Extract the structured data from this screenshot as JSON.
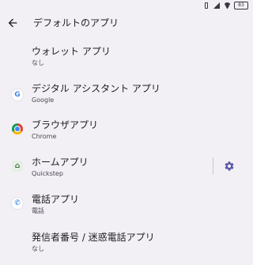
{
  "status": {
    "battery": "83"
  },
  "appbar": {
    "title": "デフォルトのアプリ"
  },
  "items": [
    {
      "title": "ウォレット アプリ",
      "subtitle": "なし",
      "icon": "none"
    },
    {
      "title": "デジタル アシスタント アプリ",
      "subtitle": "Google",
      "icon": "google-icon"
    },
    {
      "title": "ブラウザアプリ",
      "subtitle": "Chrome",
      "icon": "chrome-icon"
    },
    {
      "title": "ホームアプリ",
      "subtitle": "Quickstep",
      "icon": "home-icon"
    },
    {
      "title": "電話アプリ",
      "subtitle": "電話",
      "icon": "phone-icon"
    },
    {
      "title": "発信者番号 / 迷惑電話アプリ",
      "subtitle": "なし",
      "icon": "none"
    }
  ],
  "colors": {
    "background": "#f2f0f5",
    "accent": "#5b57a6"
  }
}
